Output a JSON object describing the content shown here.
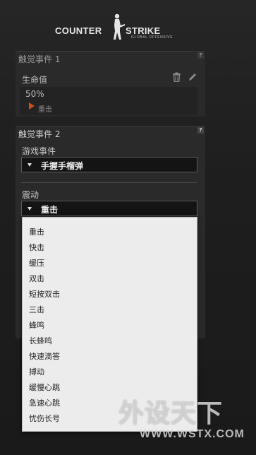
{
  "logo": {
    "left": "COUNTER",
    "right": "STRIKE",
    "subtitle": "GLOBAL OFFENSIVE"
  },
  "event1": {
    "title": "触觉事件 1",
    "help": "?",
    "label": "生命值",
    "value": "50%",
    "effect": "重击"
  },
  "event2": {
    "title": "触觉事件 2",
    "help": "?",
    "game_event_label": "游戏事件",
    "game_event_value": "手握手榴弹",
    "vibration_label": "震动",
    "vibration_value": "重击",
    "options": [
      "重击",
      "快击",
      "缓压",
      "双击",
      "短按双击",
      "三击",
      "蜂鸣",
      "长蜂鸣",
      "快速滴答",
      "搏动",
      "缓慢心跳",
      "急速心跳",
      "忧伤长号"
    ]
  },
  "watermark": {
    "big": "外设天下",
    "small": "WWW.WSTX.COM"
  }
}
